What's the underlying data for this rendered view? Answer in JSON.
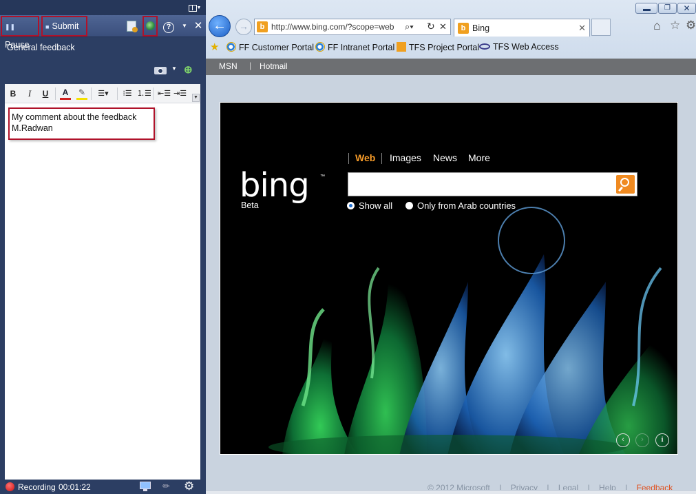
{
  "feedback_panel": {
    "toolbar": {
      "pause_label": "Pause",
      "submit_label": "Submit"
    },
    "heading": "General feedback",
    "comment_lines": [
      "My comment about the feedback",
      "M.Radwan"
    ],
    "status": {
      "recording_label": "Recording",
      "elapsed": "00:01:22"
    }
  },
  "browser": {
    "address": "http://www.bing.com/?scope=web",
    "tab_title": "Bing",
    "favorites": [
      "FF Customer Portal",
      "FF Intranet Portal",
      "TFS Project Portal",
      "TFS Web Access"
    ],
    "page": {
      "nav": [
        "MSN",
        "Hotmail"
      ],
      "logo_caption": "Beta",
      "scopes": [
        "Web",
        "Images",
        "News",
        "More"
      ],
      "search_placeholder": "",
      "radio_options": [
        "Show all",
        "Only from Arab countries"
      ],
      "selected_radio": "Show all",
      "footer": [
        "© 2012 Microsoft",
        "|",
        "Privacy",
        "|",
        "Legal",
        "|",
        "Help",
        "|",
        "Feedback"
      ]
    }
  },
  "colors": {
    "panel_bg": "#2c3e63",
    "highlight_border": "#b0122a",
    "bing_accent": "#f79c29",
    "recording_red": "#d01010"
  }
}
